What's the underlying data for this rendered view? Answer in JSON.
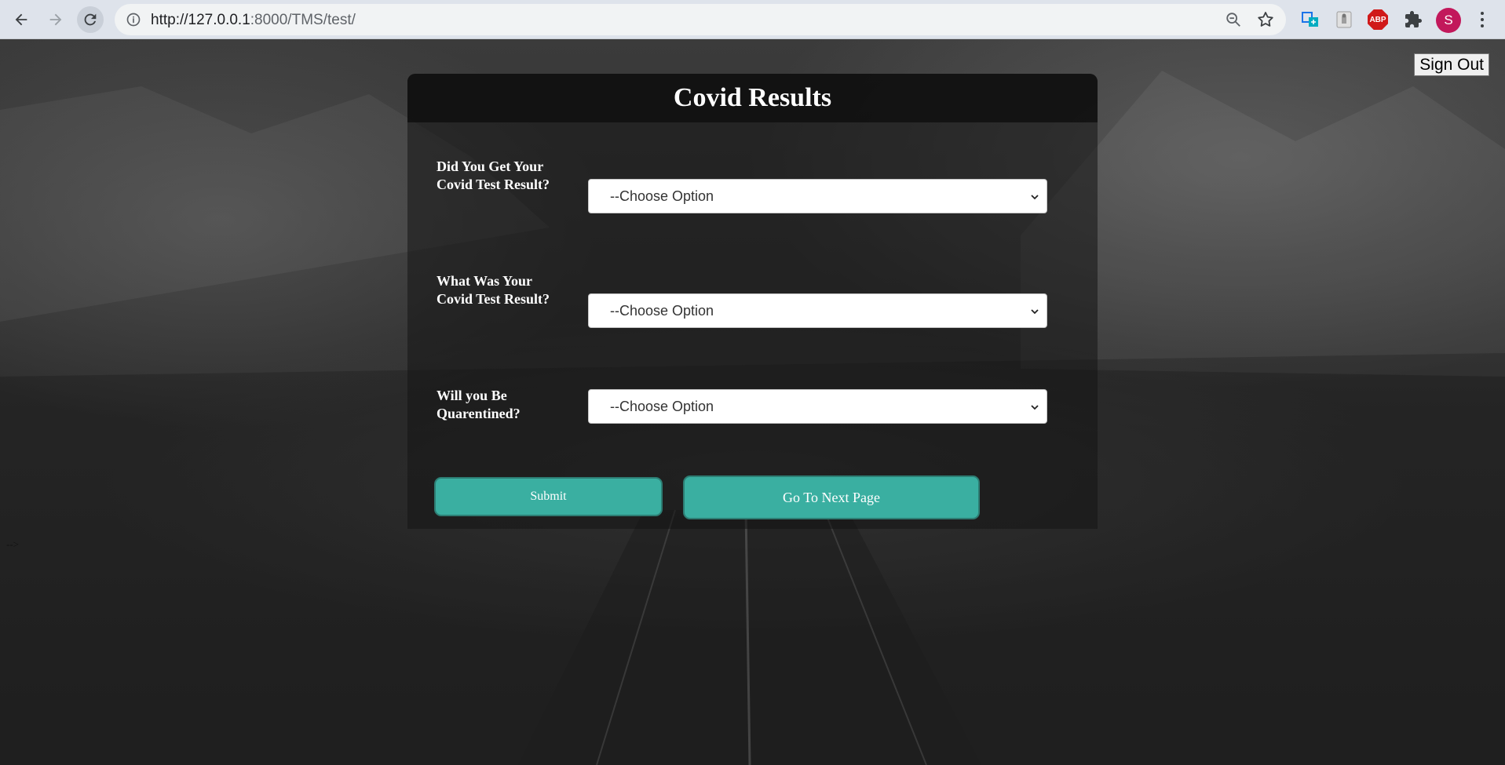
{
  "browser": {
    "url_host": "http://127.0.0.1",
    "url_rest": ":8000/TMS/test/",
    "profile_initial": "S",
    "abp_label": "ABP"
  },
  "page": {
    "sign_out_label": "Sign Out",
    "stray_text": "-->"
  },
  "form": {
    "title": "Covid Results",
    "questions": [
      {
        "label": "Did You Get Your Covid Test Result?",
        "selected": "--Choose Option"
      },
      {
        "label": "What Was Your Covid Test Result?",
        "selected": "--Choose Option"
      },
      {
        "label": "Will you Be Quarentined?",
        "selected": "--Choose Option"
      }
    ],
    "submit_label": "Submit",
    "next_label": "Go To Next Page"
  },
  "colors": {
    "button_teal": "#3aafa1",
    "profile_pink": "#c2185b",
    "abp_red": "#d01919"
  }
}
